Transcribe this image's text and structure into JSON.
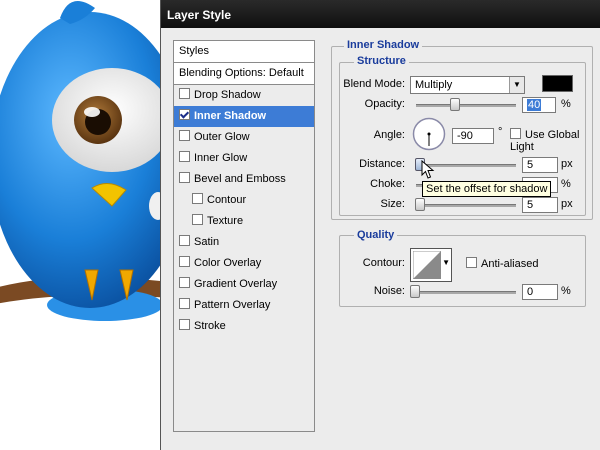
{
  "window": {
    "title": "Layer Style"
  },
  "styles_panel": {
    "header": "Styles",
    "blending": "Blending Options: Default",
    "items": [
      {
        "label": "Drop Shadow",
        "checked": false,
        "selected": false,
        "sub": false
      },
      {
        "label": "Inner Shadow",
        "checked": true,
        "selected": true,
        "sub": false
      },
      {
        "label": "Outer Glow",
        "checked": false,
        "selected": false,
        "sub": false
      },
      {
        "label": "Inner Glow",
        "checked": false,
        "selected": false,
        "sub": false
      },
      {
        "label": "Bevel and Emboss",
        "checked": false,
        "selected": false,
        "sub": false
      },
      {
        "label": "Contour",
        "checked": false,
        "selected": false,
        "sub": true
      },
      {
        "label": "Texture",
        "checked": false,
        "selected": false,
        "sub": true
      },
      {
        "label": "Satin",
        "checked": false,
        "selected": false,
        "sub": false
      },
      {
        "label": "Color Overlay",
        "checked": false,
        "selected": false,
        "sub": false
      },
      {
        "label": "Gradient Overlay",
        "checked": false,
        "selected": false,
        "sub": false
      },
      {
        "label": "Pattern Overlay",
        "checked": false,
        "selected": false,
        "sub": false
      },
      {
        "label": "Stroke",
        "checked": false,
        "selected": false,
        "sub": false
      }
    ]
  },
  "inner_shadow": {
    "section_title": "Inner Shadow",
    "structure_title": "Structure",
    "blend_mode_label": "Blend Mode:",
    "blend_mode_value": "Multiply",
    "shadow_color": "#000000",
    "opacity_label": "Opacity:",
    "opacity_value": "40",
    "opacity_unit": "%",
    "opacity_level": 40,
    "angle_label": "Angle:",
    "angle_value": "-90",
    "angle_unit": "°",
    "use_global_light_label": "Use Global Light",
    "distance_label": "Distance:",
    "distance_value": "5",
    "distance_unit": "px",
    "choke_label": "Choke:",
    "choke_unit": "%",
    "size_label": "Size:",
    "size_value": "5",
    "size_unit": "px",
    "tooltip": "Set the offset for shadow"
  },
  "quality": {
    "title": "Quality",
    "contour_label": "Contour:",
    "anti_aliased_label": "Anti-aliased",
    "noise_label": "Noise:",
    "noise_value": "0",
    "noise_unit": "%"
  },
  "colors": {
    "accent": "#3d7cd6",
    "section_title": "#1a3c9c",
    "bird_blue": "#1a7fd8"
  }
}
